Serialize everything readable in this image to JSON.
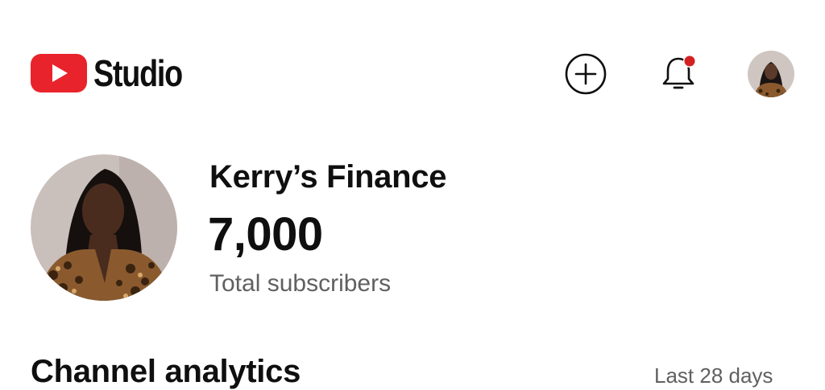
{
  "app": {
    "title": "Studio",
    "brand_color": "#ff0000",
    "icons": {
      "logo": "youtube-play-icon",
      "create": "add-circle-icon",
      "notifications": "bell-icon",
      "notification_dot_color": "#d32121"
    }
  },
  "channel": {
    "name": "Kerry’s Finance",
    "subscriber_count": "7,000",
    "subscriber_label": "Total subscribers"
  },
  "analytics": {
    "title": "Channel analytics",
    "range": "Last 28 days"
  }
}
